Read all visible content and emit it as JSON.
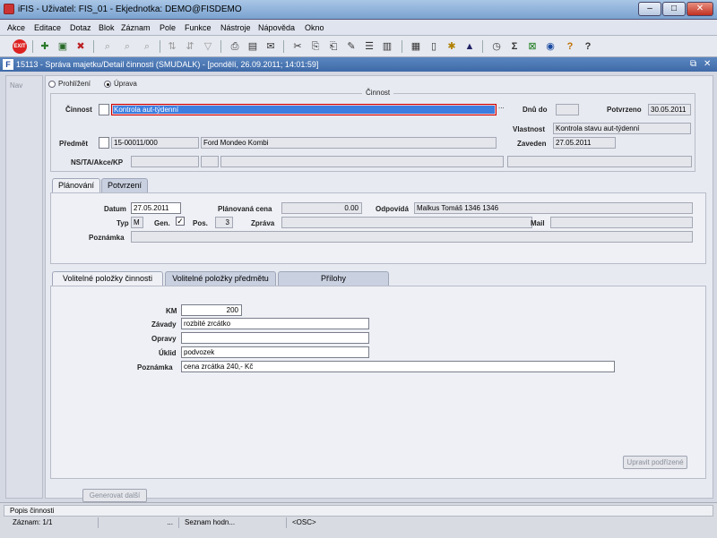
{
  "window": {
    "title": "iFIS - Uživatel: FIS_01 - Ekjednotka: DEMO@FISDEMO",
    "min": "–",
    "max": "□",
    "close": "✕"
  },
  "menu": [
    "Akce",
    "Editace",
    "Dotaz",
    "Blok",
    "Záznam",
    "Pole",
    "Funkce",
    "Nástroje",
    "Nápověda",
    "Okno"
  ],
  "toolbar": {
    "exit_label": "EXIT",
    "sum_label": "Σ",
    "help_label": "?"
  },
  "form": {
    "title": "15113 - Správa majetku/Detail činnosti (SMUDALK) - [pondělí, 26.09.2011; 14:01:59]",
    "icon_label": "F",
    "restore": "⧉",
    "close": "✕"
  },
  "left": {
    "nav_label": "Nav"
  },
  "mode": {
    "prohlizeni": "Prohlížení",
    "uprava": "Úprava",
    "selected": "Úprava"
  },
  "cinnost": {
    "section_title": "Činnost",
    "cinnost_label": "Činnost",
    "cinnost_value": "Kontrola aut-týdenní",
    "dots": "...",
    "dnu_do_label": "Dnů do",
    "dnu_do_value": "",
    "potvrzeno_label": "Potvrzeno",
    "potvrzeno_value": "30.05.2011",
    "vlastnost_label": "Vlastnost",
    "vlastnost_value": "Kontrola stavu aut-týdenní",
    "predmet_label": "Předmět",
    "predmet_code": "15-00011/000",
    "predmet_name": "Ford Mondeo Kombi",
    "zaveden_label": "Zaveden",
    "zaveden_value": "27.05.2011",
    "ns_label": "NS/TA/Akce/KP"
  },
  "tabs1": {
    "planovani": "Plánování",
    "potvrzeni": "Potvrzení"
  },
  "planovani": {
    "datum_label": "Datum",
    "datum_value": "27.05.2011",
    "planovana_cena_label": "Plánovaná cena",
    "planovana_cena_value": "0.00",
    "odpovida_label": "Odpovídá",
    "odpovida_value": "Malkus Tomáš 1346 1346",
    "typ_label": "Typ",
    "typ_value": "M",
    "gen_label": "Gen.",
    "gen_checked": "✓",
    "pos_label": "Pos.",
    "pos_value": "3",
    "zprava_label": "Zpráva",
    "mail_label": "Mail",
    "poznamka_label": "Poznámka"
  },
  "tabs2": {
    "volitelne_cinnosti": "Volitelné položky činnosti",
    "volitelne_predmetu": "Volitelné položky předmětu",
    "prilohy": "Přílohy"
  },
  "volitelne": {
    "km_label": "KM",
    "km_value": "200",
    "zavady_label": "Závady",
    "zavady_value": "rozbité zrcátko",
    "opravy_label": "Opravy",
    "opravy_value": "",
    "uklid_label": "Úklid",
    "uklid_value": "podvozek",
    "poznamka_label": "Poznámka",
    "poznamka_value": "cena zrcátka 240,- Kč",
    "upravit_button": "Upravit podřízené"
  },
  "bottom": {
    "generovat_button": "Generovat další"
  },
  "status": {
    "line1": "Popis činnosti",
    "zaznam": "Záznam: 1/1",
    "dots": "...",
    "seznam": "Seznam hodn...",
    "osc": "<OSC>"
  }
}
